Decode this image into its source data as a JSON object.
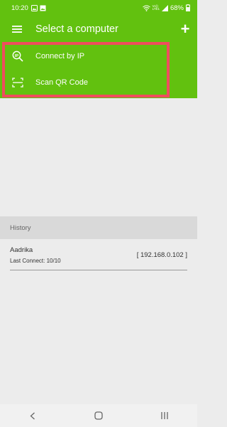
{
  "status_bar": {
    "time": "10:20",
    "battery": "68%",
    "icons": [
      "image-icon",
      "gallery-icon",
      "wifi-icon",
      "volte-icon",
      "signal-icon",
      "battery-icon"
    ],
    "volte_lines": [
      "Vo))",
      "LTE1"
    ]
  },
  "app_bar": {
    "title": "Select a computer",
    "menu_icon": "menu-icon",
    "add_icon": "plus-icon",
    "add_label": "+"
  },
  "menu": {
    "items": [
      {
        "label": "Connect by IP",
        "icon": "ip-search-icon"
      },
      {
        "label": "Scan QR Code",
        "icon": "qr-scan-icon"
      }
    ]
  },
  "history": {
    "header": "History",
    "entries": [
      {
        "name": "Aadrika",
        "last_connect": "Last Connect: 10/10",
        "ip": "[ 192.168.0.102 ]"
      }
    ]
  },
  "colors": {
    "primary": "#62c10f",
    "highlight": "#ef4d5e",
    "background": "#ececec",
    "history_header": "#d9d9d9"
  },
  "nav_bar": {
    "buttons": [
      "back-icon",
      "home-icon",
      "recents-icon"
    ]
  }
}
